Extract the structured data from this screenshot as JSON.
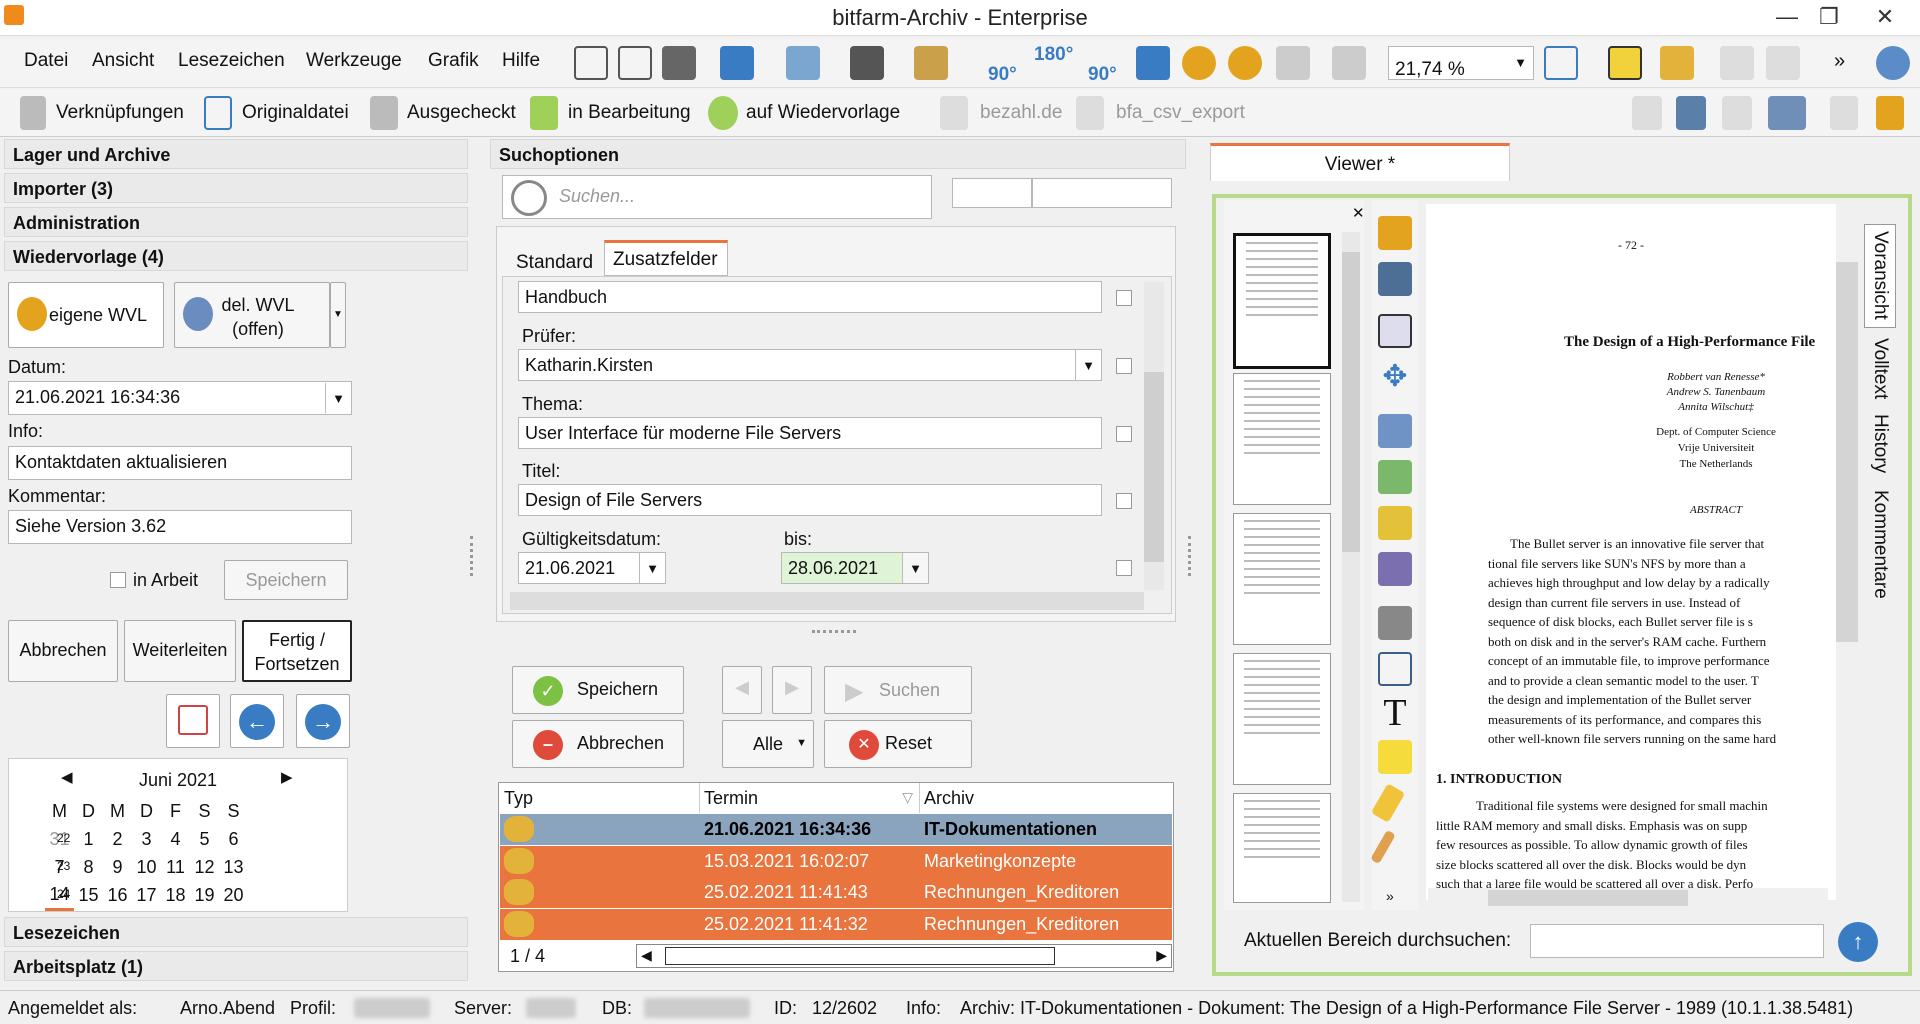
{
  "window": {
    "title": "bitfarm-Archiv - Enterprise",
    "min": "—",
    "max": "❐",
    "close": "✕"
  },
  "menu": [
    "Datei",
    "Ansicht",
    "Lesezeichen",
    "Werkzeuge",
    "Grafik",
    "Hilfe"
  ],
  "toolbar": {
    "zoom": "21,74 %",
    "rotate_180": "180°",
    "rotate_left": "90°",
    "rotate_right": "90°",
    "more": "»"
  },
  "actions": {
    "links": "Verknüpfungen",
    "original": "Originaldatei",
    "checkedout": "Ausgecheckt",
    "editing": "in Bearbeitung",
    "resubmission": "auf Wiedervorlage",
    "bezahl": "bezahl.de",
    "csv": "bfa_csv_export"
  },
  "left": {
    "sections": {
      "lager": "Lager und Archive",
      "importer": "Importer (3)",
      "admin": "Administration",
      "wvl": "Wiedervorlage (4)",
      "lesezeichen": "Lesezeichen",
      "arbeitsplatz": "Arbeitsplatz (1)"
    },
    "own_wvl": "eigene WVL",
    "del_wvl": "del. WVL (offen)",
    "date_label": "Datum:",
    "date_value": "21.06.2021 16:34:36",
    "info_label": "Info:",
    "info_value": "Kontaktdaten aktualisieren",
    "comment_label": "Kommentar:",
    "comment_value": "Siehe Version 3.62",
    "in_work": "in Arbeit",
    "save": "Speichern",
    "cancel": "Abbrechen",
    "forward": "Weiterleiten",
    "done": "Fertig / Fortsetzen",
    "calendar": {
      "month": "Juni 2021",
      "weekdays": [
        "M",
        "D",
        "M",
        "D",
        "F",
        "S",
        "S"
      ],
      "weeks": [
        {
          "kw": "22",
          "days": [
            "31",
            "1",
            "2",
            "3",
            "4",
            "5",
            "6"
          ]
        },
        {
          "kw": "23",
          "days": [
            "7",
            "8",
            "9",
            "10",
            "11",
            "12",
            "13"
          ]
        },
        {
          "kw": "24",
          "days": [
            "14",
            "15",
            "16",
            "17",
            "18",
            "19",
            "20"
          ]
        }
      ]
    }
  },
  "search": {
    "header": "Suchoptionen",
    "placeholder": "Suchen...",
    "tabs": [
      "Standard",
      "Zusatzfelder"
    ],
    "f_handbuch": "Handbuch",
    "pruefer_label": "Prüfer:",
    "pruefer_value": "Katharin.Kirsten",
    "thema_label": "Thema:",
    "thema_value": "User Interface für moderne File Servers",
    "titel_label": "Titel:",
    "titel_value": "Design of File Servers",
    "valid_label": "Gültigkeitsdatum:",
    "valid_value": "21.06.2021",
    "bis_label": "bis:",
    "bis_value": "28.06.2021",
    "btn_save": "Speichern",
    "btn_cancel": "Abbrechen",
    "btn_search": "Suchen",
    "btn_all": "Alle",
    "btn_reset": "Reset"
  },
  "results": {
    "columns": [
      "Typ",
      "Termin",
      "Archiv"
    ],
    "rows": [
      {
        "termin": "21.06.2021 16:34:36",
        "archiv": "IT-Dokumentationen"
      },
      {
        "termin": "15.03.2021 16:02:07",
        "archiv": "Marketingkonzepte"
      },
      {
        "termin": "25.02.2021 11:41:43",
        "archiv": "Rechnungen_Kreditoren"
      },
      {
        "termin": "25.02.2021 11:41:32",
        "archiv": "Rechnungen_Kreditoren"
      }
    ],
    "pager": "1 / 4"
  },
  "viewer": {
    "tab": "Viewer *",
    "side_tabs": [
      "Voransicht",
      "Volltext",
      "History",
      "Kommentare"
    ],
    "search_label": "Aktuellen Bereich durchsuchen:",
    "doc": {
      "page": "- 72 -",
      "title": "The Design of a High-Performance File",
      "authors": [
        "Robbert van Renesse*",
        "Andrew S. Tanenbaum",
        "Annita Wilschut‡"
      ],
      "affil": [
        "Dept. of Computer Science",
        "Vrije Universiteit",
        "The Netherlands"
      ],
      "abstract_h": "ABSTRACT",
      "abstract": [
        "The Bullet server is an innovative file server that",
        "tional file servers like SUN's NFS by more than a",
        "achieves high throughput and low delay by a radically",
        "design than current file servers in use.  Instead of",
        "sequence of disk blocks, each Bullet server file is s",
        "both on disk and in the server's RAM cache.  Furthern",
        "concept of an immutable file, to improve performance",
        "and to provide a clean semantic model to the user.  T",
        "the design and implementation of the Bullet server",
        "measurements of its performance, and compares this",
        "other well-known file servers running on the same hard"
      ],
      "intro_h": "1. INTRODUCTION",
      "intro": [
        "Traditional file systems were designed for small machin",
        "little RAM memory and small disks. Emphasis was on supp",
        "few resources as possible.  To allow dynamic growth of files",
        "size blocks scattered all over the disk.  Blocks would be dyn",
        "such that a large file would be scattered all over a disk.  Perfo"
      ]
    }
  },
  "status": {
    "user_label": "Angemeldet als:",
    "user": "Arno.Abend",
    "profile_label": "Profil:",
    "server_label": "Server:",
    "db_label": "DB:",
    "id_label": "ID:",
    "id": "12/2602",
    "info_label": "Info:",
    "info": "Archiv: IT-Dokumentationen - Dokument: The Design of a High-Performance File Server - 1989 (10.1.1.38.5481)"
  },
  "colors": {
    "accent": "#e9743e",
    "selected": "#8aa4bd",
    "viewer_border": "#b7d98a"
  }
}
